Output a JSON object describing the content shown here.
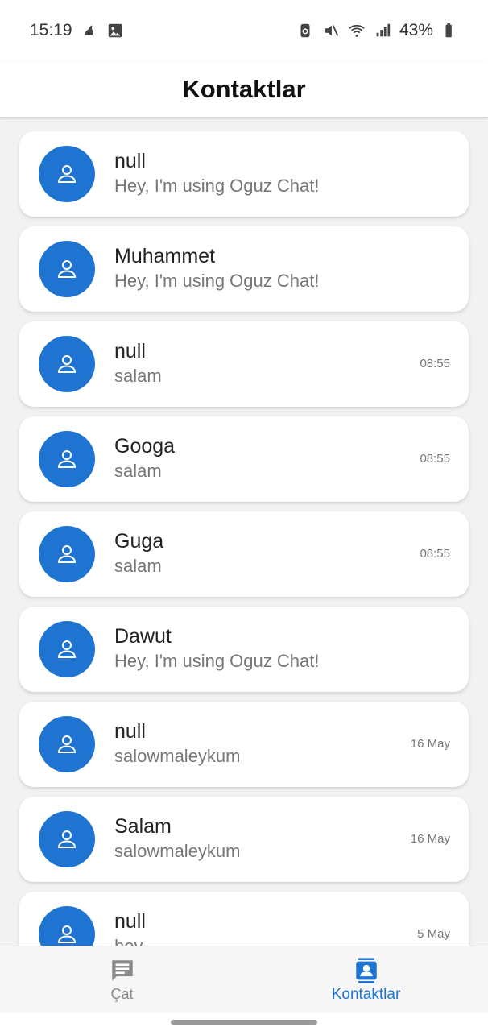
{
  "status_bar": {
    "time": "15:19",
    "battery": "43%",
    "left_icons": [
      "notification-icon",
      "image-icon"
    ],
    "right_icons": [
      "battery-saver-icon",
      "mute-icon",
      "wifi-icon",
      "signal-icon",
      "battery-icon"
    ]
  },
  "header": {
    "title": "Kontaktlar"
  },
  "contacts": [
    {
      "name": "null",
      "message": "Hey, I'm using Oguz Chat!",
      "time": ""
    },
    {
      "name": "Muhammet",
      "message": "Hey, I'm using Oguz Chat!",
      "time": ""
    },
    {
      "name": "null",
      "message": "salam",
      "time": "08:55"
    },
    {
      "name": "Googa",
      "message": "salam",
      "time": "08:55"
    },
    {
      "name": "Guga",
      "message": "salam",
      "time": "08:55"
    },
    {
      "name": "Dawut",
      "message": "Hey, I'm using Oguz Chat!",
      "time": ""
    },
    {
      "name": "null",
      "message": "salowmaleykum",
      "time": "16 May"
    },
    {
      "name": "Salam",
      "message": "salowmaleykum",
      "time": "16 May"
    },
    {
      "name": "null",
      "message": "hey",
      "time": "5 May"
    }
  ],
  "bottom_nav": {
    "chat_label": "Çat",
    "contacts_label": "Kontaktlar",
    "active": "contacts"
  },
  "colors": {
    "accent": "#1f74d2",
    "inactive": "#8a8a8a",
    "background": "#f2f2f2"
  }
}
